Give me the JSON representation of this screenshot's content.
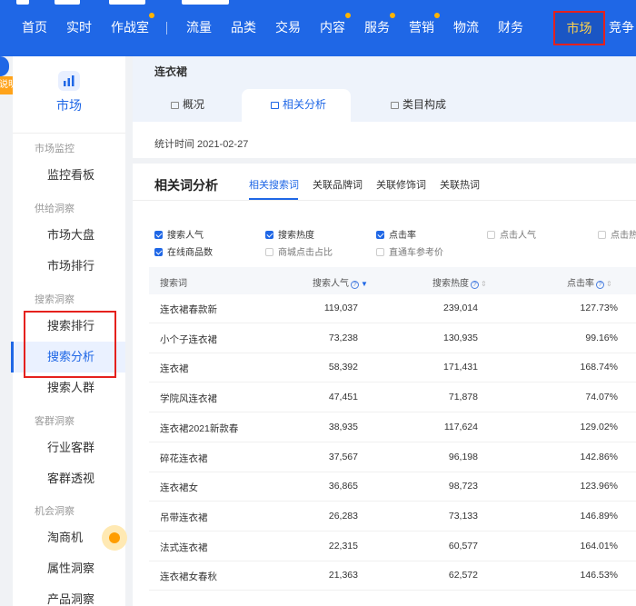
{
  "nav": {
    "items": [
      {
        "label": "首页",
        "dot": false
      },
      {
        "label": "实时",
        "dot": false
      },
      {
        "label": "作战室",
        "dot": true
      },
      {
        "label": "流量",
        "dot": false
      },
      {
        "label": "品类",
        "dot": false
      },
      {
        "label": "交易",
        "dot": false
      },
      {
        "label": "内容",
        "dot": true
      },
      {
        "label": "服务",
        "dot": true
      },
      {
        "label": "营销",
        "dot": true
      },
      {
        "label": "物流",
        "dot": false
      },
      {
        "label": "财务",
        "dot": false
      }
    ],
    "active_label": "市场",
    "overflow_label": "竞争"
  },
  "badges": {
    "shuoming": "说明"
  },
  "sidebar": {
    "title": "市场",
    "groups": [
      {
        "label": "市场监控",
        "items": [
          "监控看板"
        ]
      },
      {
        "label": "供给洞察",
        "items": [
          "市场大盘",
          "市场排行"
        ]
      },
      {
        "label": "搜索洞察",
        "items": [
          "搜索排行",
          "搜索分析",
          "搜索人群"
        ]
      },
      {
        "label": "客群洞察",
        "items": [
          "行业客群",
          "客群透视"
        ]
      },
      {
        "label": "机会洞察",
        "items": [
          "淘商机",
          "属性洞察",
          "产品洞察"
        ]
      }
    ],
    "active_item": "搜索分析"
  },
  "header_card": {
    "keyword": "连衣裙",
    "tabs": [
      "概况",
      "相关分析",
      "类目构成"
    ],
    "active_tab": "相关分析",
    "stat_time": "统计时间 2021-02-27"
  },
  "analysis": {
    "title": "相关词分析",
    "tabs": [
      "相关搜索词",
      "关联品牌词",
      "关联修饰词",
      "关联热词"
    ],
    "active_tab": "相关搜索词",
    "metrics": [
      {
        "label": "搜索人气",
        "checked": true
      },
      {
        "label": "搜索热度",
        "checked": true
      },
      {
        "label": "点击率",
        "checked": true
      },
      {
        "label": "点击人气",
        "checked": false
      },
      {
        "label": "点击热",
        "checked": false
      },
      {
        "label": "在线商品数",
        "checked": true
      },
      {
        "label": "商城点击占比",
        "checked": false
      },
      {
        "label": "直通车参考价",
        "checked": false
      }
    ],
    "columns": [
      "搜索词",
      "搜索人气",
      "搜索热度",
      "点击率"
    ],
    "rows": [
      {
        "word": "连衣裙春款新",
        "popularity": "119,037",
        "heat": "239,014",
        "ctr": "127.73%"
      },
      {
        "word": "小个子连衣裙",
        "popularity": "73,238",
        "heat": "130,935",
        "ctr": "99.16%"
      },
      {
        "word": "连衣裙",
        "popularity": "58,392",
        "heat": "171,431",
        "ctr": "168.74%"
      },
      {
        "word": "学院风连衣裙",
        "popularity": "47,451",
        "heat": "71,878",
        "ctr": "74.07%"
      },
      {
        "word": "连衣裙2021新款春",
        "popularity": "38,935",
        "heat": "117,624",
        "ctr": "129.02%"
      },
      {
        "word": "碎花连衣裙",
        "popularity": "37,567",
        "heat": "96,198",
        "ctr": "142.86%"
      },
      {
        "word": "连衣裙女",
        "popularity": "36,865",
        "heat": "98,723",
        "ctr": "123.96%"
      },
      {
        "word": "吊带连衣裙",
        "popularity": "26,283",
        "heat": "73,133",
        "ctr": "146.89%"
      },
      {
        "word": "法式连衣裙",
        "popularity": "22,315",
        "heat": "60,577",
        "ctr": "164.01%"
      },
      {
        "word": "连衣裙女春秋",
        "popularity": "21,363",
        "heat": "62,572",
        "ctr": "146.53%"
      }
    ]
  }
}
